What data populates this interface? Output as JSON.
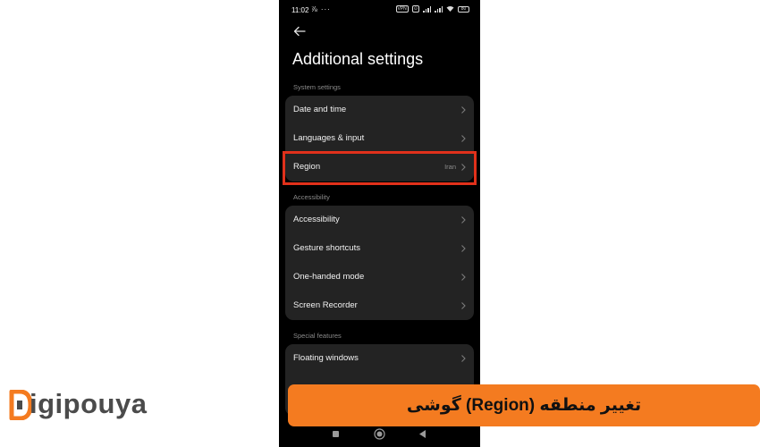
{
  "status_bar": {
    "time": "11:02",
    "left_icons": "⅞ ···",
    "chip1": "VPN",
    "chip2": "⊙",
    "battery": "80"
  },
  "header": {
    "back_icon": "arrow-left-icon",
    "title": "Additional settings"
  },
  "sections": [
    {
      "label": "System settings",
      "items": [
        {
          "label": "Date and time",
          "value": ""
        },
        {
          "label": "Languages & input",
          "value": ""
        },
        {
          "label": "Region",
          "value": "Iran",
          "highlighted": true
        }
      ]
    },
    {
      "label": "Accessibility",
      "items": [
        {
          "label": "Accessibility",
          "value": ""
        },
        {
          "label": "Gesture shortcuts",
          "value": ""
        },
        {
          "label": "One-handed mode",
          "value": ""
        },
        {
          "label": "Screen Recorder",
          "value": ""
        }
      ]
    },
    {
      "label": "Special features",
      "items": [
        {
          "label": "Floating windows",
          "value": ""
        }
      ]
    }
  ],
  "banner": {
    "text": "تغییر منطقه (Region) گوشی",
    "color": "#f47b20"
  },
  "logo": {
    "text": "igipouya",
    "mark_color": "#f47b20"
  },
  "colors": {
    "highlight": "#e1311b",
    "card": "#232323"
  }
}
